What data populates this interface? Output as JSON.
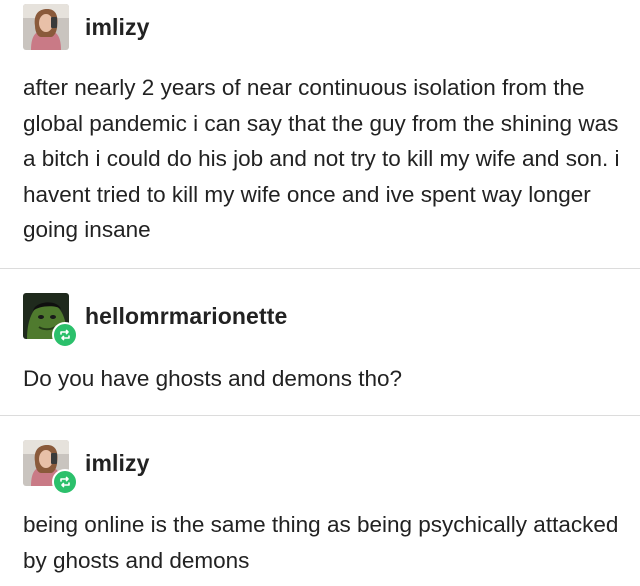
{
  "posts": [
    {
      "username": "imlizy",
      "avatar_icon": "user-avatar-photo",
      "reblogged": false,
      "text": "after nearly 2 years of near continuous isolation from the global pandemic i can say that the guy from the shining was a bitch i could do his job and not try to kill my wife and son. i havent tried to kill my wife once and ive spent way longer going insane"
    },
    {
      "username": "hellomrmarionette",
      "avatar_icon": "hulk-avatar",
      "reblogged": true,
      "text": "Do you have ghosts and demons tho?"
    },
    {
      "username": "imlizy",
      "avatar_icon": "user-avatar-photo",
      "reblogged": true,
      "text": "being online is the same thing as being psychically attacked by ghosts and demons"
    }
  ],
  "colors": {
    "reblog_badge": "#2bc06b",
    "divider": "#dcdcdc",
    "text": "#222222"
  }
}
